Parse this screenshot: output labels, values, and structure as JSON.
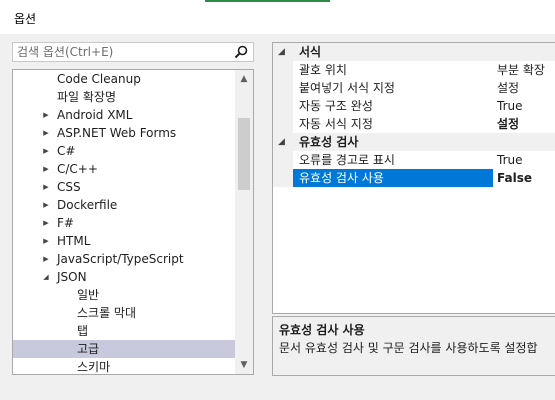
{
  "window": {
    "title": "옵션"
  },
  "search": {
    "placeholder": "검색 옵션(Ctrl+E)"
  },
  "tree": {
    "items": [
      {
        "label": "Code Cleanup",
        "arrow": ""
      },
      {
        "label": "파일 확장명",
        "arrow": ""
      },
      {
        "label": "Android XML",
        "arrow": "▶"
      },
      {
        "label": "ASP.NET Web Forms",
        "arrow": "▶"
      },
      {
        "label": "C#",
        "arrow": "▶"
      },
      {
        "label": "C/C++",
        "arrow": "▶"
      },
      {
        "label": "CSS",
        "arrow": "▶"
      },
      {
        "label": "Dockerfile",
        "arrow": "▶"
      },
      {
        "label": "F#",
        "arrow": "▶"
      },
      {
        "label": "HTML",
        "arrow": "▶"
      },
      {
        "label": "JavaScript/TypeScript",
        "arrow": "▶"
      },
      {
        "label": "JSON",
        "arrow": "◢"
      },
      {
        "label": "일반",
        "arrow": ""
      },
      {
        "label": "스크롤 막대",
        "arrow": ""
      },
      {
        "label": "탭",
        "arrow": ""
      },
      {
        "label": "고급",
        "arrow": ""
      },
      {
        "label": "스키마",
        "arrow": ""
      }
    ],
    "selected_index": 15,
    "scroll_up": "▲",
    "scroll_down": "▼"
  },
  "grid": {
    "sections": [
      {
        "label": "서식",
        "caret": "◢",
        "props": [
          {
            "name": "괄호 위치",
            "value": "부분 확장",
            "bold": false
          },
          {
            "name": "붙여넣기 서식 지정",
            "value": "설정",
            "bold": false
          },
          {
            "name": "자동 구조 완성",
            "value": "True",
            "bold": false
          },
          {
            "name": "자동 서식 지정",
            "value": "설정",
            "bold": true
          }
        ]
      },
      {
        "label": "유효성 검사",
        "caret": "◢",
        "props": [
          {
            "name": "오류를 경고로 표시",
            "value": "True",
            "bold": false
          },
          {
            "name": "유효성 검사 사용",
            "value": "False",
            "bold": true,
            "selected": true
          }
        ]
      }
    ]
  },
  "description": {
    "title": "유효성 검사 사용",
    "text": "문서 유효성 검사 및 구문 검사를 사용하도록 설정합"
  },
  "colors": {
    "accent_line": "#2d8a4a",
    "selection": "#0078d7",
    "tree_selection": "#c9c9dd"
  }
}
